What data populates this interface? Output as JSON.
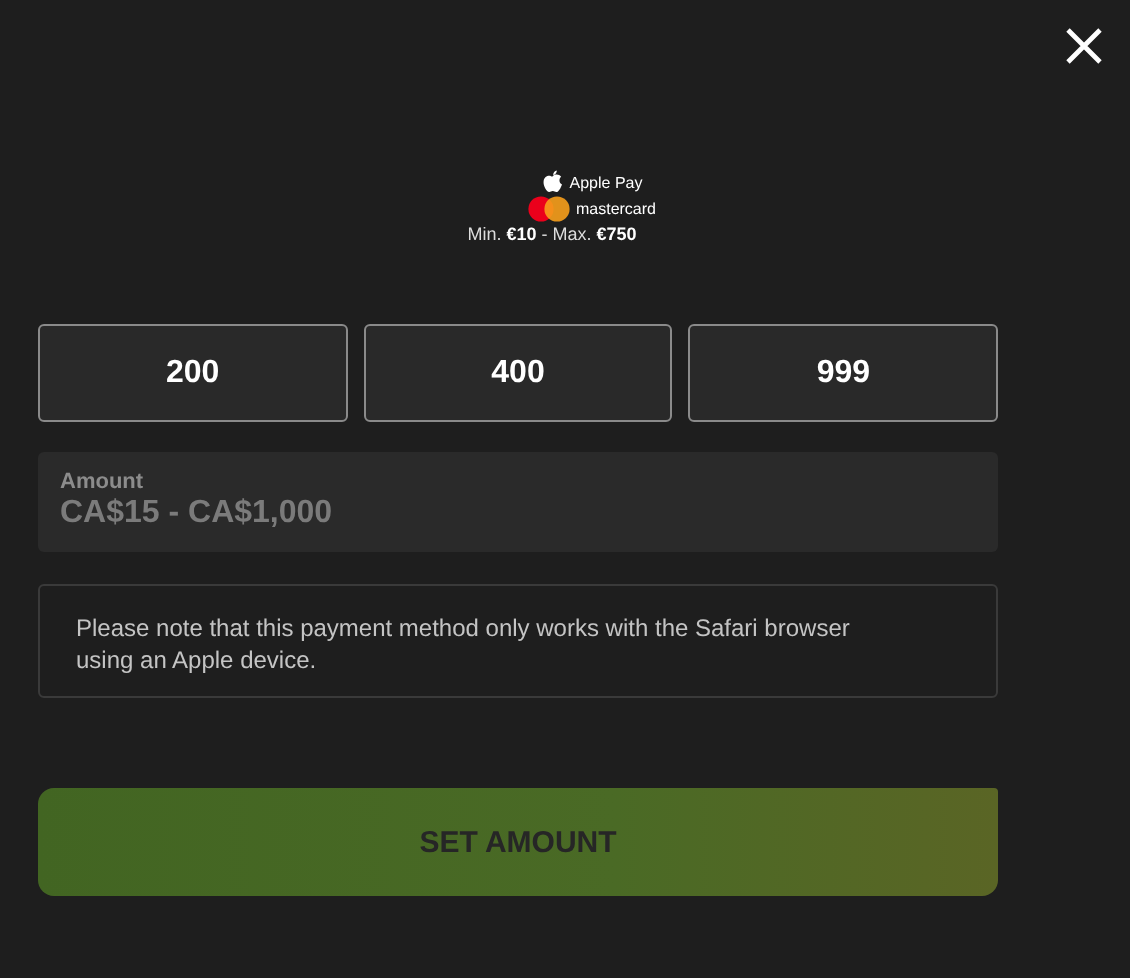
{
  "header": {
    "methods": [
      {
        "kind": "apple",
        "label": "Apple Pay"
      },
      {
        "kind": "mastercard",
        "label": "mastercard"
      }
    ],
    "limits": "Min. **€10** - Max. **€750**"
  },
  "presets": [
    "200",
    "400",
    "999"
  ],
  "amount": {
    "label": "Amount",
    "placeholder": "CA$15 - CA$1,000"
  },
  "note": "Please note that this payment method only works with the Safari browser using an Apple device.",
  "submit": "SET AMOUNT"
}
